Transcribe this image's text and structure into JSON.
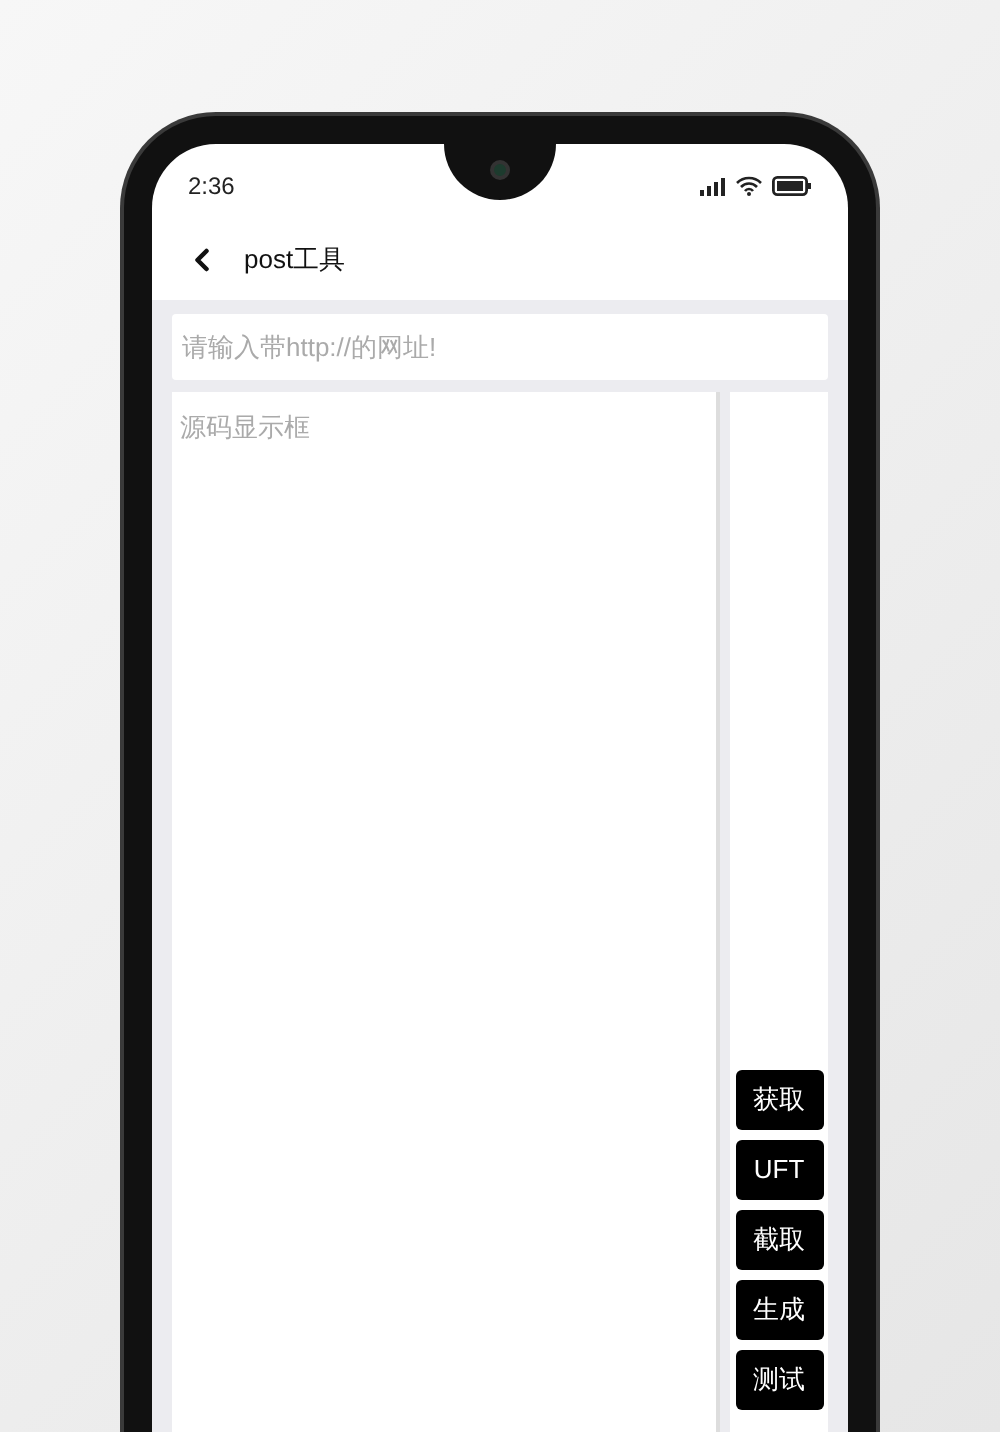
{
  "status_bar": {
    "time": "2:36"
  },
  "header": {
    "title": "post工具"
  },
  "url_field": {
    "placeholder": "请输入带http://的网址!"
  },
  "source_box": {
    "placeholder": "源码显示框"
  },
  "buttons": [
    "获取",
    "UFT",
    "截取",
    "生成",
    "测试"
  ]
}
